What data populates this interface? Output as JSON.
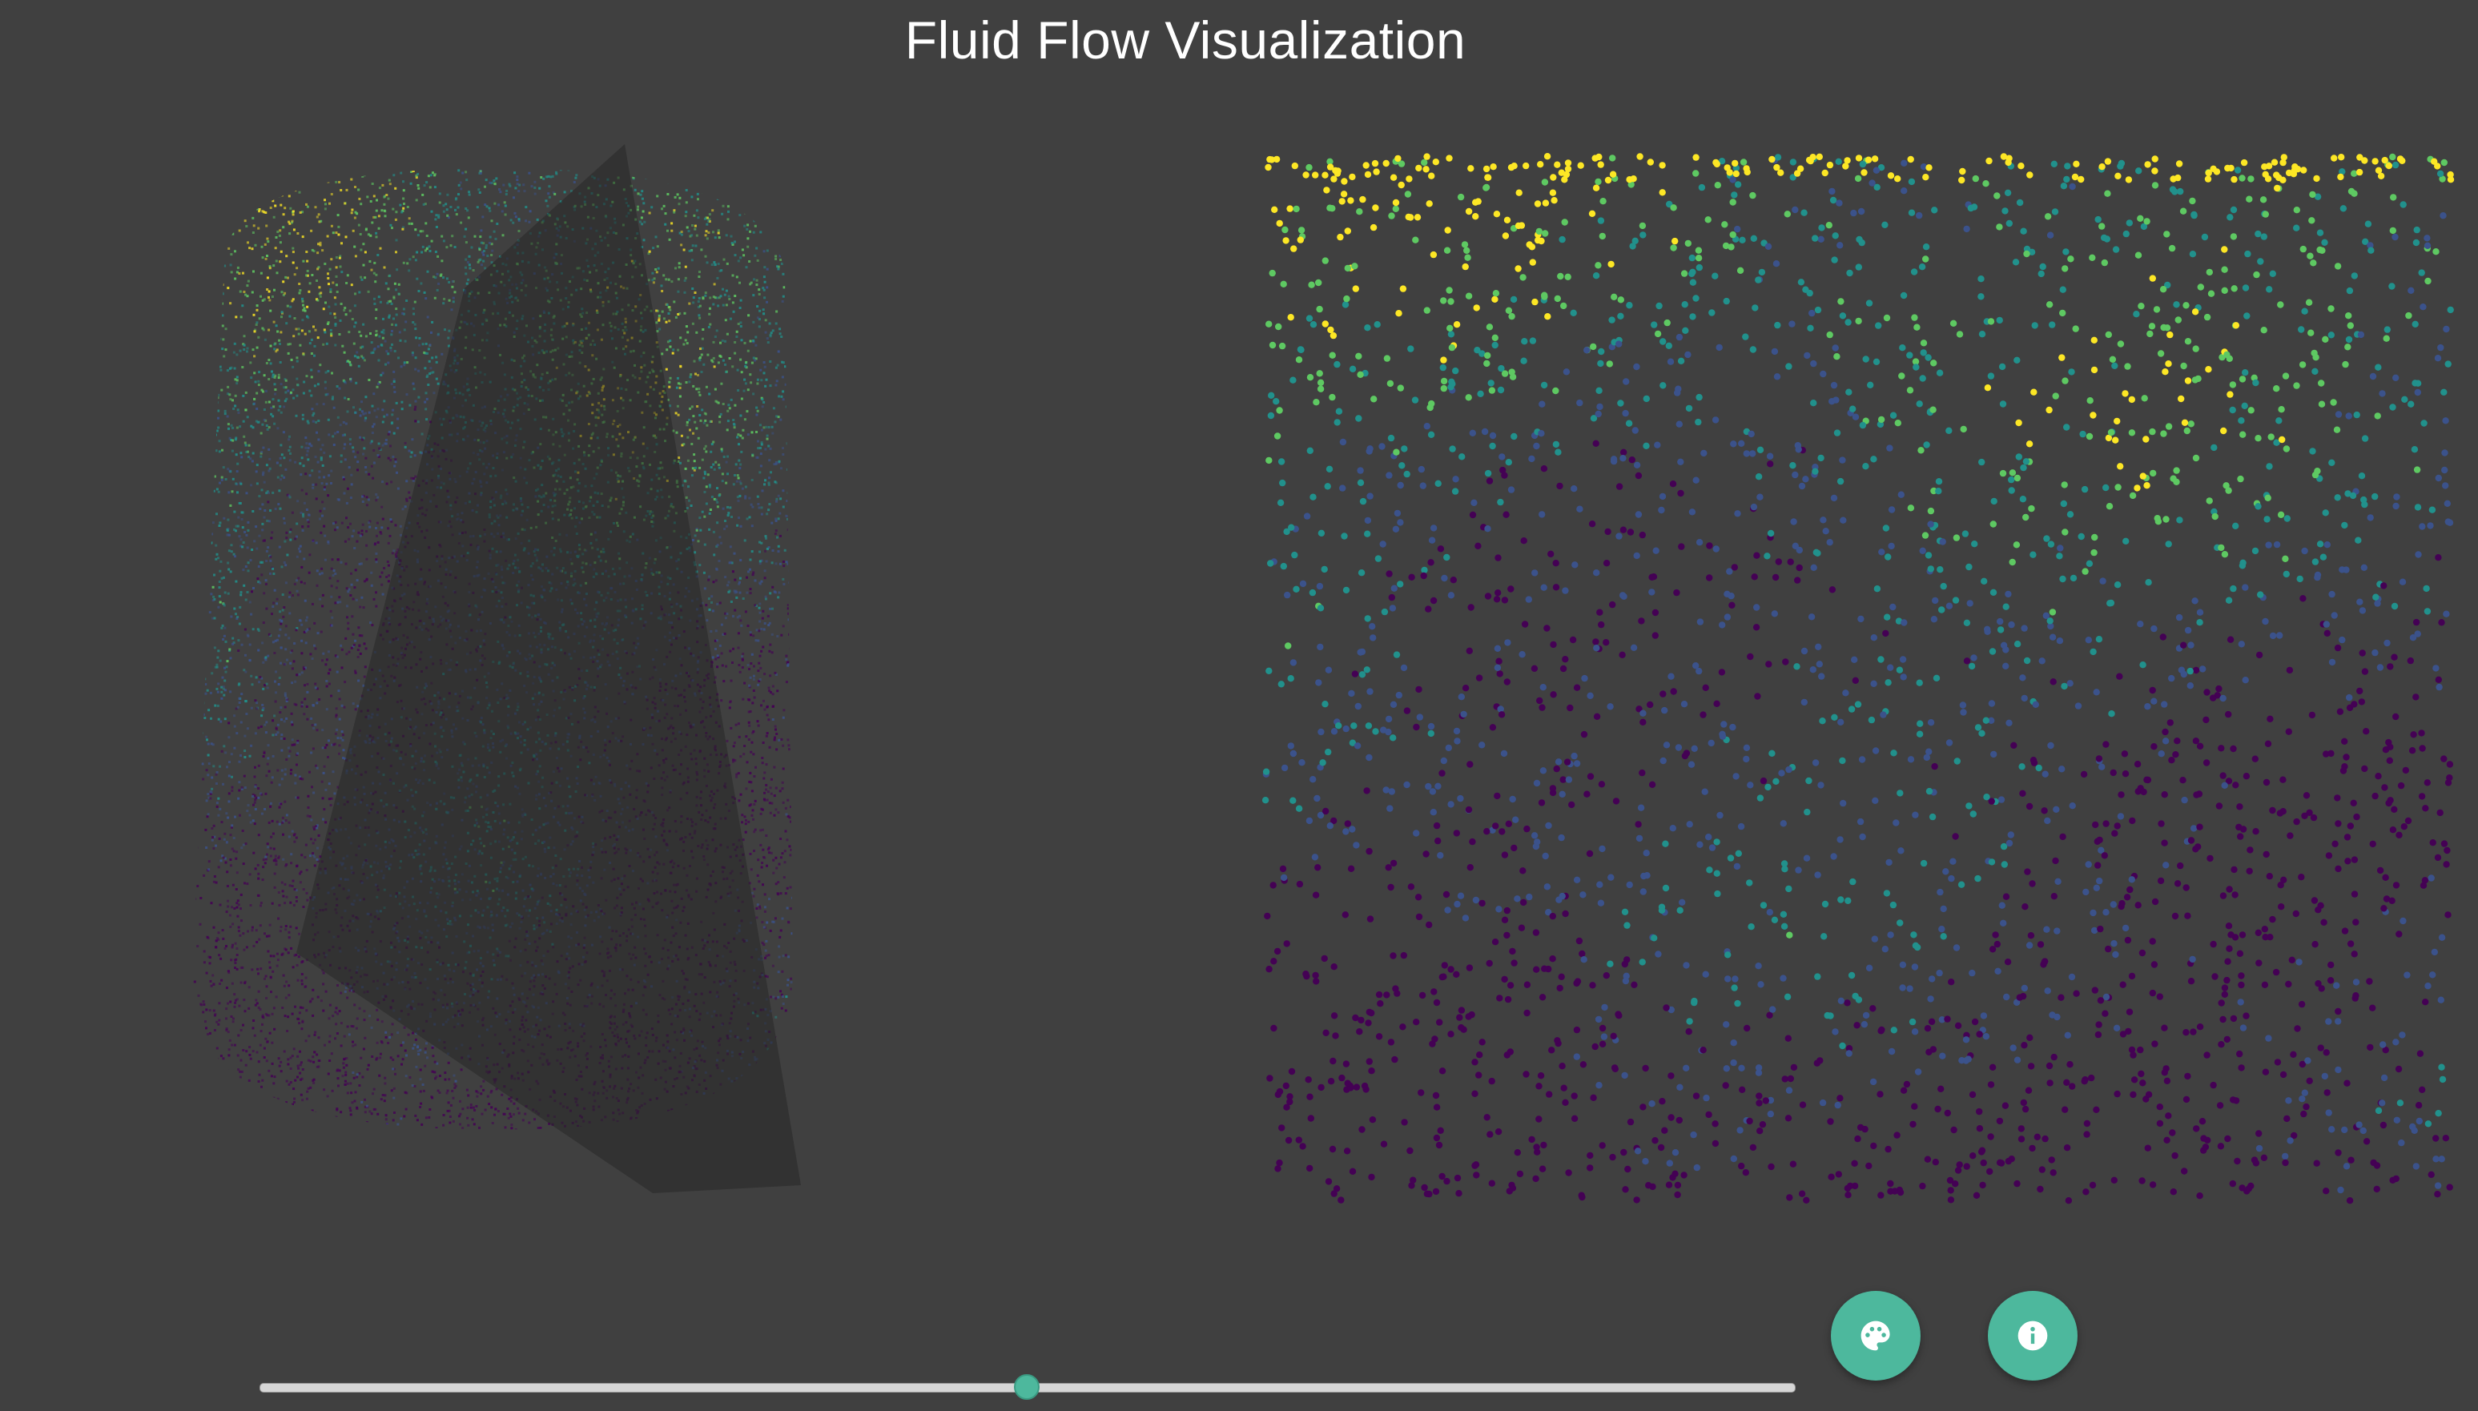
{
  "title": "Fluid Flow Visualization",
  "colors": {
    "background": "#404040",
    "accent": "#4db89d",
    "viridis": [
      "#440154",
      "#3b528b",
      "#21918c",
      "#5ec962",
      "#fde725"
    ]
  },
  "views": {
    "volume": {
      "kind": "3d-point-cloud-cylinder-with-slice-plane"
    },
    "slice": {
      "kind": "2d-scatter-slice"
    }
  },
  "buttons": {
    "palette": {
      "icon": "palette-icon"
    },
    "info": {
      "icon": "info-icon"
    }
  },
  "slider": {
    "value": 0.5
  }
}
